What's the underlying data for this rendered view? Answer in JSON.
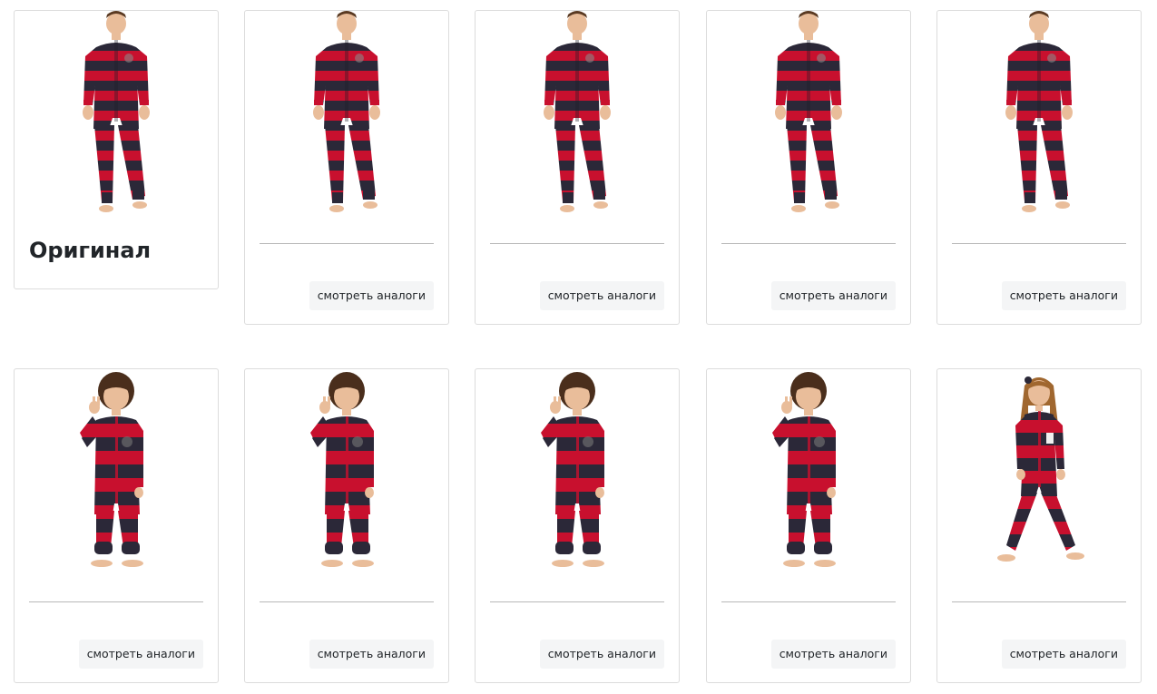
{
  "original": {
    "title": "Оригинал",
    "image_icon": "adult-striped-onesie-photo"
  },
  "results": [
    {
      "button_label": "смотреть аналоги",
      "image_icon": "adult-striped-onesie-photo"
    },
    {
      "button_label": "смотреть аналоги",
      "image_icon": "adult-striped-onesie-photo"
    },
    {
      "button_label": "смотреть аналоги",
      "image_icon": "adult-striped-onesie-photo"
    },
    {
      "button_label": "смотреть аналоги",
      "image_icon": "adult-striped-onesie-photo"
    },
    {
      "button_label": "смотреть аналоги",
      "image_icon": "child-striped-onesie-photo"
    },
    {
      "button_label": "смотреть аналоги",
      "image_icon": "child-striped-onesie-photo"
    },
    {
      "button_label": "смотреть аналоги",
      "image_icon": "child-striped-onesie-photo"
    },
    {
      "button_label": "смотреть аналоги",
      "image_icon": "child-striped-onesie-photo"
    },
    {
      "button_label": "смотреть аналоги",
      "image_icon": "girl-striped-onesie-photo"
    }
  ],
  "colors": {
    "stripe_red": "#c8102e",
    "stripe_navy": "#2b2838",
    "skin": "#e9bd9a",
    "hair_dark": "#4a2e1c",
    "hair_light": "#a0672f"
  }
}
